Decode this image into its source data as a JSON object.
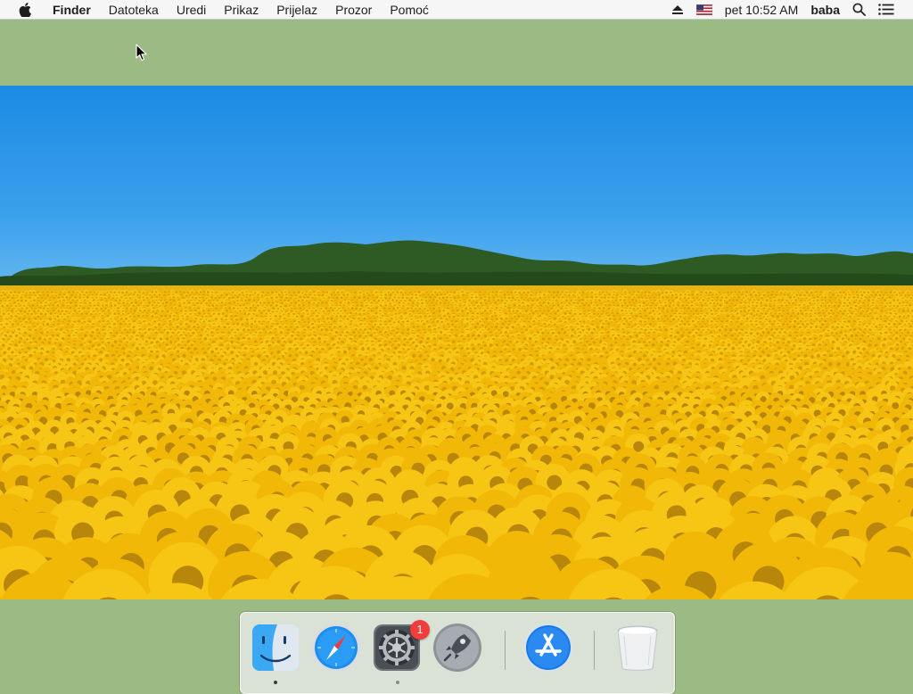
{
  "menubar": {
    "app_name": "Finder",
    "menus": [
      "Datoteka",
      "Uredi",
      "Prikaz",
      "Prijelaz",
      "Prozor",
      "Pomoć"
    ],
    "status": {
      "clock": "pet 10:52 AM",
      "user": "baba",
      "input_source": "us-flag-icon"
    }
  },
  "dock": {
    "items": [
      {
        "name": "Finder",
        "icon": "finder-icon",
        "running": true
      },
      {
        "name": "Safari",
        "icon": "safari-icon",
        "running": false
      },
      {
        "name": "System Preferences",
        "icon": "system-preferences-icon",
        "running": true,
        "badge": "1"
      },
      {
        "name": "Launchpad",
        "icon": "launchpad-icon",
        "running": false
      },
      {
        "name": "App Store",
        "icon": "app-store-icon",
        "running": false
      },
      {
        "name": "Trash",
        "icon": "trash-icon",
        "running": false
      }
    ]
  },
  "colors": {
    "desktop_background": "#9bba84",
    "menubar_background": "#f6f6f6",
    "badge": "#f33d3a"
  }
}
